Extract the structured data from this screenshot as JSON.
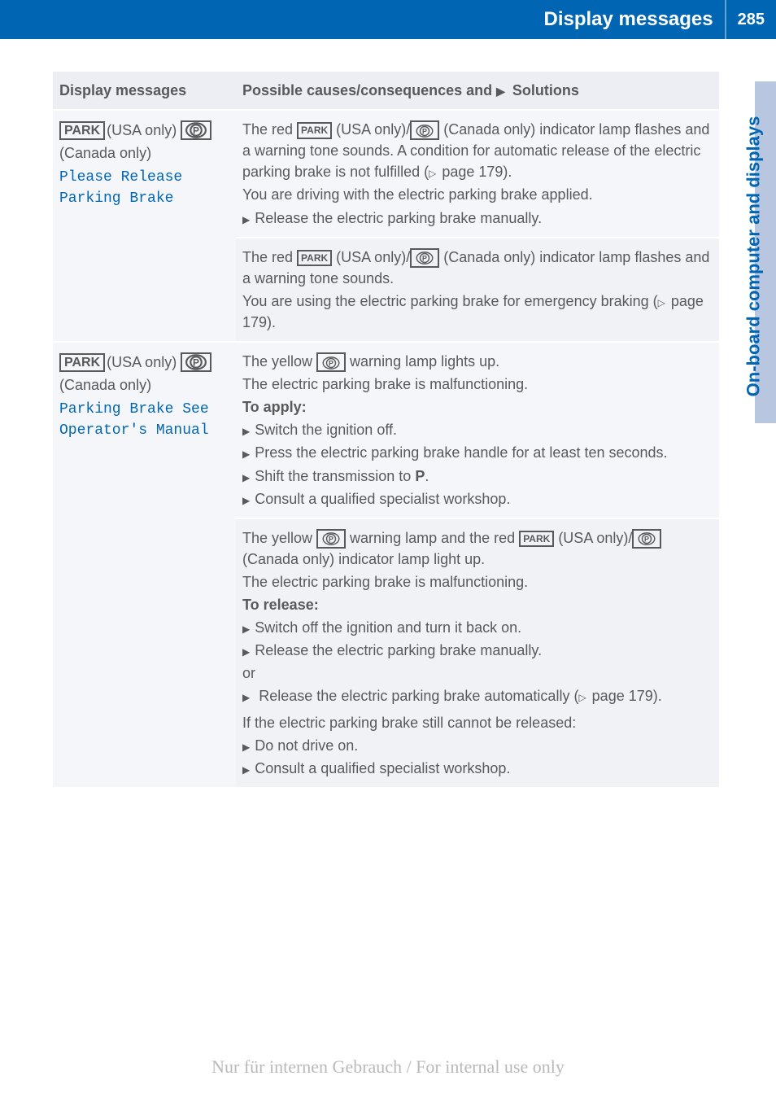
{
  "header": {
    "title": "Display messages",
    "page_number": "285"
  },
  "side_tab": "On-board computer and displays",
  "table": {
    "col1_header": "Display messages",
    "col2_header_prefix": "Possible causes/consequences and ",
    "col2_header_suffix": " Solutions",
    "rows": [
      {
        "left": {
          "park_label": "PARK",
          "usa_text": "(USA only)",
          "canada_text": "(Canada only)",
          "model_line1": "Please Release",
          "model_line2": "Parking Brake"
        },
        "right_blocks": [
          {
            "p1_a": "The red ",
            "p1_park": "PARK",
            "p1_b": " (USA only)/",
            "p1_c": " (Canada only) indicator lamp flashes and a warning tone sounds. A condition for automatic release of the electric parking brake is not fulfilled (",
            "p1_d": " page 179).",
            "p2": "You are driving with the electric parking brake applied.",
            "bullets": [
              "Release the electric parking brake manually."
            ]
          },
          {
            "p1_a": "The red ",
            "p1_park": "PARK",
            "p1_b": " (USA only)/",
            "p1_c": " (Canada only) indicator lamp flashes and a warning tone sounds.",
            "p2_a": "You are using the electric parking brake for emergency braking (",
            "p2_b": " page 179)."
          }
        ]
      },
      {
        "left": {
          "park_label": "PARK",
          "usa_text": "(USA only)",
          "canada_text": "(Canada only)",
          "model_line1": "Parking Brake See",
          "model_line2": "Operator's Manual"
        },
        "right_blocks": [
          {
            "p1_a": "The yellow ",
            "p1_b": " warning lamp lights up.",
            "p2": "The electric parking brake is malfunctioning.",
            "label": "To apply:",
            "bullets": [
              "Switch the ignition off.",
              "Press the electric parking brake handle for at least ten seconds.",
              "Shift the transmission to P.",
              "Consult a qualified specialist workshop."
            ],
            "bold_p": "P"
          },
          {
            "p1_a": "The yellow ",
            "p1_b": " warning lamp and the red ",
            "p1_park": "PARK",
            "p1_c": " (USA only)/",
            "p1_d": " (Canada only) indicator lamp light up.",
            "p2": "The electric parking brake is malfunctioning.",
            "label": "To release:",
            "bullets1": [
              "Switch off the ignition and turn it back on.",
              "Release the electric parking brake manually."
            ],
            "or_text": "or",
            "bullet2_a": "Release the electric parking brake automatically (",
            "bullet2_b": " page 179).",
            "p3": "If the electric parking brake still cannot be released:",
            "bullets3": [
              "Do not drive on.",
              "Consult a qualified specialist workshop."
            ]
          }
        ]
      }
    ]
  },
  "watermark": "Nur für internen Gebrauch / For internal use only"
}
